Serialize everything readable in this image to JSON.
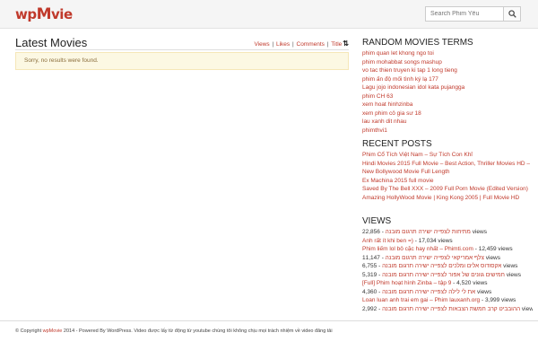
{
  "header": {
    "logo_prefix": "wp",
    "logo_main": "M",
    "logo_suffix": "vie",
    "search_placeholder": "Search Phim Yêu"
  },
  "main": {
    "title": "Latest Movies",
    "sort": [
      "Views",
      "Likes",
      "Comments",
      "Title"
    ],
    "sort_arrow": "⇅",
    "alert": "Sorry, no results were found."
  },
  "random_terms": {
    "title": "RANDOM MOVIES TERMS",
    "items": [
      "phim quan let khong ngo toi",
      "phim mohabbat songs mashup",
      "vo tac thien truyen ki tap 1 long tieng",
      "phim ấn độ mối tình ký lạ 177",
      "Lagu jojo indonesian idol kata pujangga",
      "phim CH 63",
      "xem hoat hinhzinba",
      "xem phim cô gia sư 18",
      "lau xanh dit nhau",
      "phimthvi1"
    ]
  },
  "recent_posts": {
    "title": "RECENT POSTS",
    "items": [
      "Phim Cổ Tích Việt Nam – Sự Tích Con Khỉ",
      "Hindi Movies 2015 Full Movie – Best Action, Thriller Movies HD – New Bollywood Movie Full Length",
      "Ex Machina 2015 full movie",
      "Saved By The Bell XXX – 2009 Full Porn Movie (Edited Version)",
      "Amazing HollyWood Movie | King Kong 2005 | Full Movie HD"
    ]
  },
  "views": {
    "title": "VIEWS",
    "items": [
      {
        "count": "22,856",
        "title": "מתיחות לצפייה ישירה תרגום מובנה",
        "count_first": true
      },
      {
        "count": "17,034",
        "title": "Anh rất ít khi ben =)",
        "count_first": false
      },
      {
        "count": "12,459",
        "title": "Phim liếm lol bô cặc hay nhất – Phimti.com",
        "count_first": false
      },
      {
        "count": "11,147",
        "title": "צלף אמריקאי לצפייה ישירה תרגום מובנה",
        "count_first": true
      },
      {
        "count": "6,755",
        "title": "אקסודוס אלים ומלכים לצפייה ישירה תרגום מובנה",
        "count_first": true
      },
      {
        "count": "5,319",
        "title": "חמישים גוונים של אפור לצפייה ישירה תרגום מובנה",
        "count_first": true
      },
      {
        "count": "4,520",
        "title": "[Full] Phim hoạt hình Zinba – tập 9",
        "count_first": false
      },
      {
        "count": "4,360",
        "title": "את לי לילה לצפייה ישירה תרגום מובנה",
        "count_first": true
      },
      {
        "count": "3,999",
        "title": "Loan luan anh trai em gai – Phim lauxanh.org",
        "count_first": false
      },
      {
        "count": "2,992",
        "title": "ההובביט קרב חמשת הצבאות לצפייה ישירה תרגום מובנה",
        "count_first": true
      }
    ],
    "suffix": "views"
  },
  "footer": {
    "prefix": "© Copyright ",
    "brand": "wpMovie",
    "text": " 2014 - Powered By WordPress. Video được lấy từ động từ youtube chúng tôi không chịu mọi trách nhiệm về video đăng tải"
  },
  "colors": {
    "accent": "#c0392b",
    "alert_bg": "#fcf8e3"
  }
}
